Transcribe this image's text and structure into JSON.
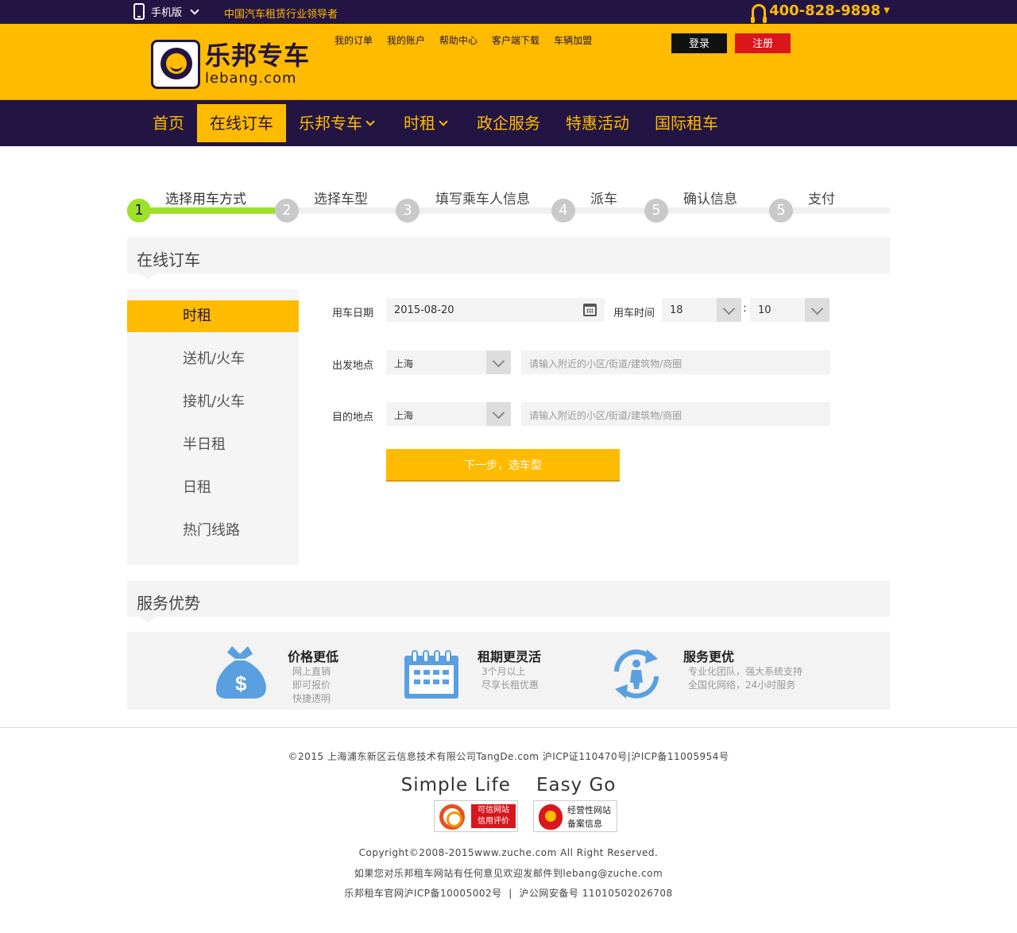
{
  "topbar": {
    "mobile_label": "手机版",
    "slogan": "中国汽车租赁行业领导者",
    "hotline": "400-828-9898"
  },
  "header": {
    "logo_cn": "乐邦专车",
    "logo_en": "lebang.com",
    "links": [
      "我的订单",
      "我的账户",
      "帮助中心",
      "客户端下载",
      "车辆加盟"
    ],
    "login": "登录",
    "register": "注册"
  },
  "nav": {
    "items": [
      "首页",
      "在线订车",
      "乐邦专车",
      "时租",
      "政企服务",
      "特惠活动",
      "国际租车"
    ],
    "active": "在线订车"
  },
  "steps": {
    "labels": [
      "选择用车方式",
      "选择车型",
      "填写乘车人信息",
      "派车",
      "确认信息",
      "支付"
    ],
    "numbers": [
      "1",
      "2",
      "3",
      "4",
      "5",
      "5"
    ],
    "current": 1
  },
  "order": {
    "title": "在线订车",
    "menu": [
      "时租",
      "送机/火车",
      "接机/火车",
      "半日租",
      "日租",
      "热门线路"
    ],
    "date_label": "用车日期",
    "date_value": "2015-08-20",
    "time_label": "用车时间",
    "hour": "18",
    "colon": ":",
    "minute": "10",
    "from_label": "出发地点",
    "from_city": "上海",
    "from_placeholder": "请输入附近的小区/街道/建筑物/商圈",
    "to_label": "目的地点",
    "to_city": "上海",
    "to_placeholder": "请输入附近的小区/街道/建筑物/商圈",
    "next_button": "下一步，选车型"
  },
  "services": {
    "title": "服务优势",
    "items": [
      {
        "title": "价格更低",
        "lines": [
          "网上直销",
          "即可报价",
          "快捷透明"
        ],
        "icon": "money-bag-icon"
      },
      {
        "title": "租期更灵活",
        "lines": [
          "3个月以上",
          "尽享长租优惠"
        ],
        "icon": "calendar-icon"
      },
      {
        "title": "服务更优",
        "lines": [
          "专业化团队，强大系统支持",
          "全国化网络，24小时服务"
        ],
        "icon": "person-cycle-icon"
      }
    ]
  },
  "footer": {
    "copyright_line": "©2015 上海浦东新区云信息技术有限公司TangDe.com 沪ICP证110470号|沪ICP备11005954号",
    "motto_left": "Simple Life",
    "motto_right": "Easy Go",
    "badge1_top": "可信网站",
    "badge1_bottom": "信用评价",
    "badge2_top": "经营性网站",
    "badge2_bottom": "备案信息",
    "rights": "Copyright©2008-2015www.zuche.com All Right Reserved.",
    "contact": "如果您对乐邦租车网站有任何意见欢迎发邮件到lebang@zuche.com",
    "icp": "乐邦租车官网沪ICP备10005002号  |  沪公网安备号 11010502026708"
  },
  "colors": {
    "brand_yellow": "#ffbb00",
    "brand_purple": "#231543",
    "step_green": "#9ce12a",
    "register_red": "#d9161c",
    "icon_blue": "#5aa0e0"
  }
}
